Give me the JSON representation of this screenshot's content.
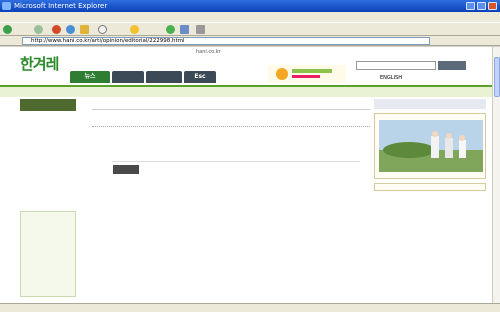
{
  "window": {
    "title": "Microsoft Internet Explorer"
  },
  "menu": [
    "",
    "",
    "",
    "",
    "",
    ""
  ],
  "toolbar": {
    "back": "",
    "search": "",
    "favorites": ""
  },
  "address": {
    "label": "",
    "url": "http://www.hani.co.kr/arti/opinion/editorial/222998.html",
    "go": "",
    "links": ""
  },
  "site": {
    "top_links": [
      "hani.co.kr",
      "",
      "",
      "",
      "",
      ""
    ],
    "login": [
      "",
      ""
    ],
    "logo": "한겨레",
    "search_button": "",
    "langs": [
      "ENGLISH",
      ""
    ]
  },
  "nav": {
    "tabs": [
      "뉴스",
      "",
      "",
      "Esc"
    ]
  },
  "subnav": [
    "",
    "",
    "",
    "",
    "",
    "",
    "",
    "",
    ""
  ],
  "leftbar": {
    "header": "",
    "items": [
      "",
      "",
      "",
      "",
      "",
      "",
      "",
      "",
      "",
      "",
      "",
      ""
    ],
    "box_items": [
      "",
      "",
      "",
      "",
      "",
      "",
      "",
      "",
      "",
      ""
    ]
  },
  "breadcrumb": [
    "",
    "",
    "",
    ""
  ],
  "tools": [
    "",
    "",
    "",
    "",
    ""
  ],
  "article": {
    "headline": "",
    "section": "",
    "label": "",
    "paragraphs": []
  },
  "rightbar": {
    "ad": "",
    "panel_title": "",
    "panel_lines": [
      "",
      "",
      ""
    ],
    "list_header": "",
    "list_items": [
      "",
      "",
      "",
      "",
      "",
      ""
    ]
  },
  "status": {
    "text": "",
    "zone": ""
  }
}
